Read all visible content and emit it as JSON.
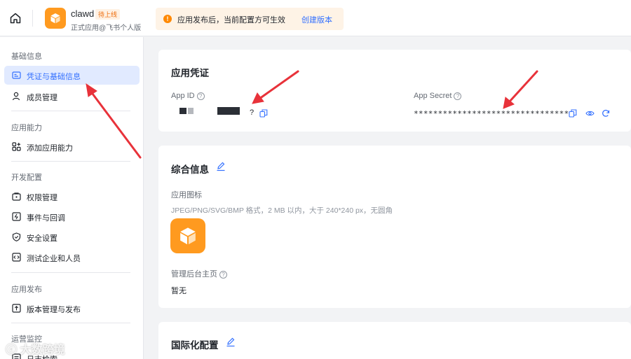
{
  "header": {
    "app_name": "clawd",
    "app_badge": "待上线",
    "app_subtitle": "正式应用@飞书个人版",
    "notice_text": "应用发布后，当前配置方可生效",
    "notice_link": "创建版本"
  },
  "sidebar": {
    "groups": [
      {
        "title": "基础信息",
        "items": [
          {
            "label": "凭证与基础信息",
            "icon": "credential-icon",
            "active": true
          },
          {
            "label": "成员管理",
            "icon": "user-icon"
          }
        ]
      },
      {
        "title": "应用能力",
        "items": [
          {
            "label": "添加应用能力",
            "icon": "apps-add-icon"
          }
        ]
      },
      {
        "title": "开发配置",
        "items": [
          {
            "label": "权限管理",
            "icon": "lock-box-icon"
          },
          {
            "label": "事件与回调",
            "icon": "event-icon"
          },
          {
            "label": "安全设置",
            "icon": "shield-icon"
          },
          {
            "label": "测试企业和人员",
            "icon": "code-icon"
          }
        ]
      },
      {
        "title": "应用发布",
        "items": [
          {
            "label": "版本管理与发布",
            "icon": "upload-icon"
          }
        ]
      },
      {
        "title": "运营监控",
        "items": [
          {
            "label": "日志检索",
            "icon": "log-icon"
          }
        ]
      }
    ]
  },
  "credentials": {
    "title": "应用凭证",
    "app_id_label": "App ID",
    "app_id_fragment": "?",
    "app_secret_label": "App Secret",
    "app_secret_value": "********************************"
  },
  "general": {
    "title": "综合信息",
    "icon_label": "应用图标",
    "icon_hint": "JPEG/PNG/SVG/BMP 格式，2 MB 以内，大于 240*240 px，无圆角",
    "admin_label": "管理后台主页",
    "admin_value": "暂无"
  },
  "i18n": {
    "title": "国际化配置"
  },
  "watermark": "大数跨境",
  "colors": {
    "accent": "#3370ff",
    "brand_orange": "#ff9a1f",
    "annotation_red": "#e8323a"
  }
}
